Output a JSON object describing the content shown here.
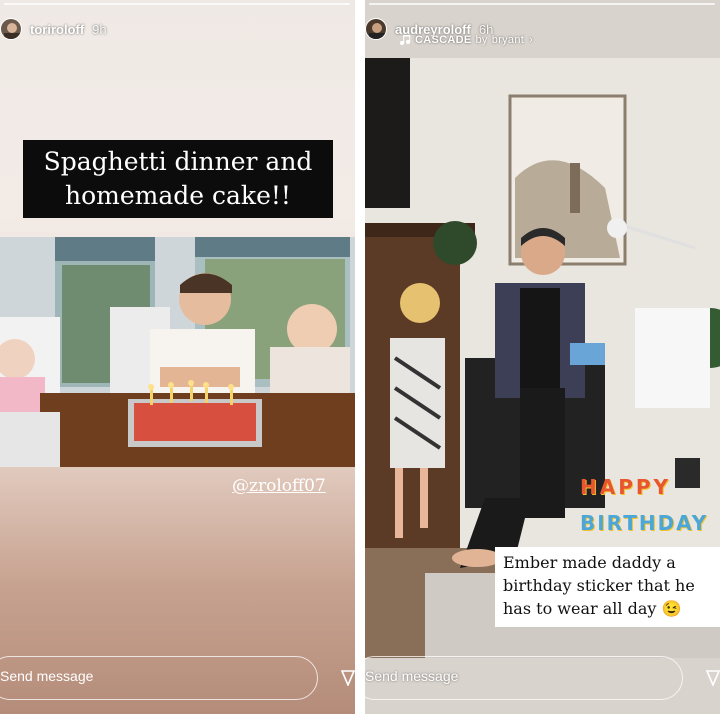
{
  "left_story": {
    "username": "toriroloff",
    "time": "9h",
    "caption": "Spaghetti dinner and homemade cake!!",
    "mention": "@zroloff07",
    "send_message_placeholder": "Send message"
  },
  "right_story": {
    "username": "audreyroloff",
    "time": "6h",
    "music_song": "CASCADE",
    "music_artist": "bryant",
    "sticker_text": "Ember made daddy a birthday sticker that he has to wear all day 😉",
    "birthday_sticker_word1": "HAPPY",
    "birthday_sticker_word2": "BIRTHDAY",
    "send_message_placeholder": "Send message"
  },
  "colors": {
    "caption_bg": "#0c0c0c",
    "story_gradient_bottom": "#b58c7a"
  }
}
